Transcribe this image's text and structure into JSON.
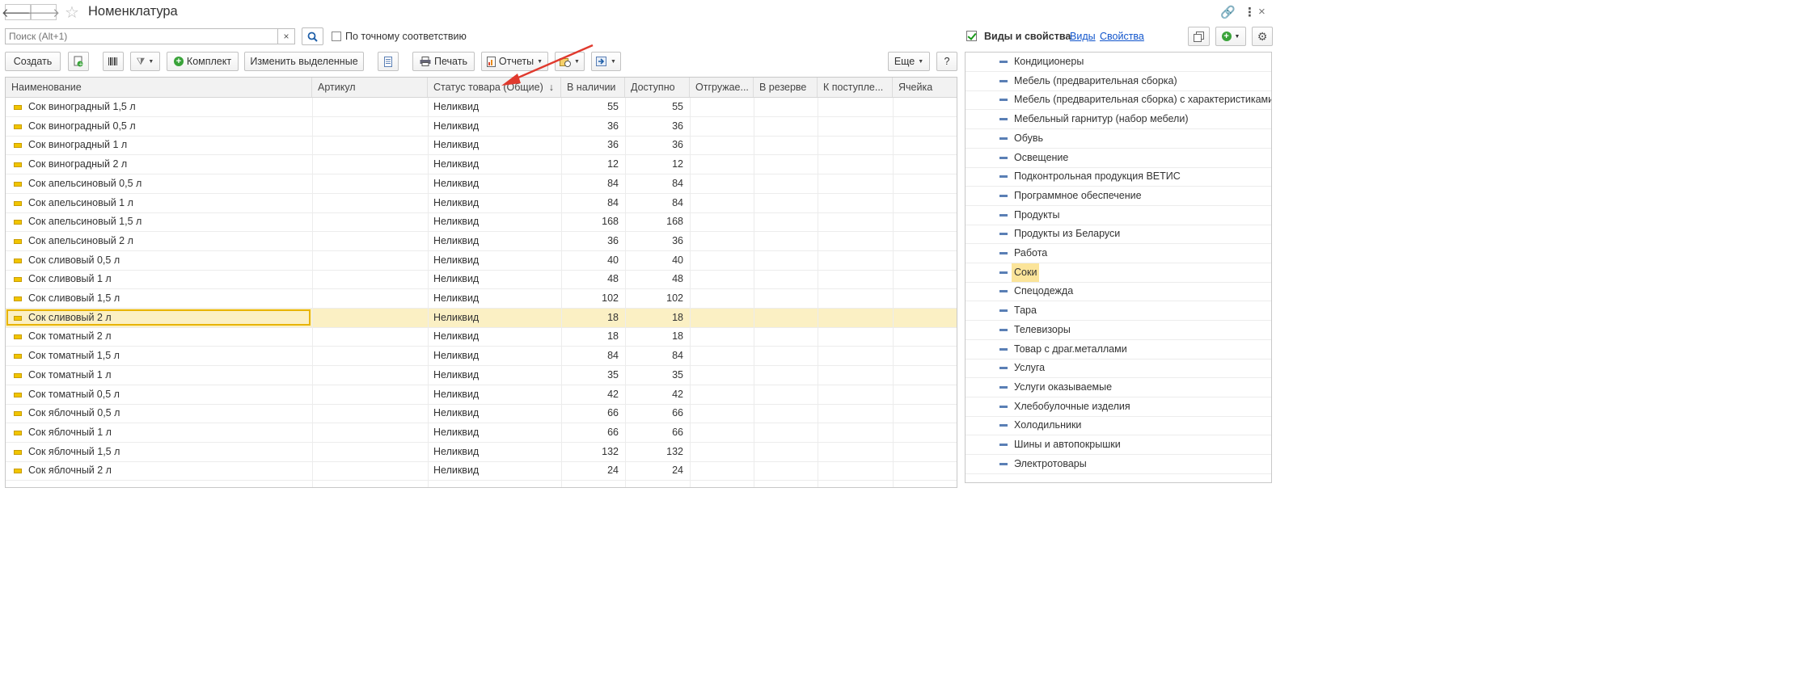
{
  "window": {
    "title": "Номенклатура"
  },
  "search": {
    "placeholder": "Поиск (Alt+1)",
    "clear": "×",
    "exact_label": "По точному соответствию"
  },
  "toolbar": {
    "create": "Создать",
    "kit": "Комплект",
    "change_selected": "Изменить выделенные",
    "print": "Печать",
    "reports": "Отчеты",
    "more": "Еще",
    "help": "?"
  },
  "table": {
    "columns": [
      "Наименование",
      "Артикул",
      "Статус товара (Общие)",
      "В наличии",
      "Доступно",
      "Отгружае...",
      "В резерве",
      "К поступле...",
      "Ячейка"
    ],
    "sort_indicator": "↓",
    "rows": [
      {
        "name": "Сок виноградный 1,5 л",
        "status": "Неликвид",
        "stock": "55",
        "available": "55"
      },
      {
        "name": "Сок виноградный 0,5 л",
        "status": "Неликвид",
        "stock": "36",
        "available": "36"
      },
      {
        "name": "Сок виноградный 1 л",
        "status": "Неликвид",
        "stock": "36",
        "available": "36"
      },
      {
        "name": "Сок виноградный 2 л",
        "status": "Неликвид",
        "stock": "12",
        "available": "12"
      },
      {
        "name": "Сок апельсиновый 0,5 л",
        "status": "Неликвид",
        "stock": "84",
        "available": "84"
      },
      {
        "name": "Сок апельсиновый 1 л",
        "status": "Неликвид",
        "stock": "84",
        "available": "84"
      },
      {
        "name": "Сок апельсиновый 1,5 л",
        "status": "Неликвид",
        "stock": "168",
        "available": "168"
      },
      {
        "name": "Сок апельсиновый 2 л",
        "status": "Неликвид",
        "stock": "36",
        "available": "36"
      },
      {
        "name": "Сок сливовый 0,5 л",
        "status": "Неликвид",
        "stock": "40",
        "available": "40"
      },
      {
        "name": "Сок сливовый 1 л",
        "status": "Неликвид",
        "stock": "48",
        "available": "48"
      },
      {
        "name": "Сок сливовый 1,5 л",
        "status": "Неликвид",
        "stock": "102",
        "available": "102"
      },
      {
        "name": "Сок сливовый 2 л",
        "status": "Неликвид",
        "stock": "18",
        "available": "18",
        "selected": true
      },
      {
        "name": "Сок томатный 2 л",
        "status": "Неликвид",
        "stock": "18",
        "available": "18"
      },
      {
        "name": "Сок томатный 1,5 л",
        "status": "Неликвид",
        "stock": "84",
        "available": "84"
      },
      {
        "name": "Сок томатный 1 л",
        "status": "Неликвид",
        "stock": "35",
        "available": "35"
      },
      {
        "name": "Сок томатный 0,5 л",
        "status": "Неликвид",
        "stock": "42",
        "available": "42"
      },
      {
        "name": "Сок яблочный 0,5 л",
        "status": "Неликвид",
        "stock": "66",
        "available": "66"
      },
      {
        "name": "Сок яблочный 1 л",
        "status": "Неликвид",
        "stock": "66",
        "available": "66"
      },
      {
        "name": "Сок яблочный 1,5 л",
        "status": "Неликвид",
        "stock": "132",
        "available": "132"
      },
      {
        "name": "Сок яблочный 2 л",
        "status": "Неликвид",
        "stock": "24",
        "available": "24"
      }
    ]
  },
  "right_panel": {
    "title": "Виды и свойства",
    "link_types": "Виды",
    "link_properties": "Свойства",
    "items": [
      {
        "label": "Кондиционеры"
      },
      {
        "label": "Мебель (предварительная сборка)"
      },
      {
        "label": "Мебель (предварительная сборка) с характеристиками"
      },
      {
        "label": "Мебельный гарнитур (набор мебели)"
      },
      {
        "label": "Обувь"
      },
      {
        "label": "Освещение"
      },
      {
        "label": "Подконтрольная продукция ВЕТИС"
      },
      {
        "label": "Программное обеспечение"
      },
      {
        "label": "Продукты"
      },
      {
        "label": "Продукты из Беларуси"
      },
      {
        "label": "Работа"
      },
      {
        "label": "Соки",
        "selected": true
      },
      {
        "label": "Спецодежда"
      },
      {
        "label": "Тара"
      },
      {
        "label": "Телевизоры"
      },
      {
        "label": "Товар с драг.металлами"
      },
      {
        "label": "Услуга"
      },
      {
        "label": "Услуги оказываемые"
      },
      {
        "label": "Хлебобулочные изделия"
      },
      {
        "label": "Холодильники"
      },
      {
        "label": "Шины и автопокрышки"
      },
      {
        "label": "Электротовары"
      }
    ]
  },
  "colors": {
    "selection_row": "#fbf0c4",
    "focus_border": "#e8b400",
    "annotation_arrow": "#e03a2e",
    "link": "#1155cc"
  }
}
